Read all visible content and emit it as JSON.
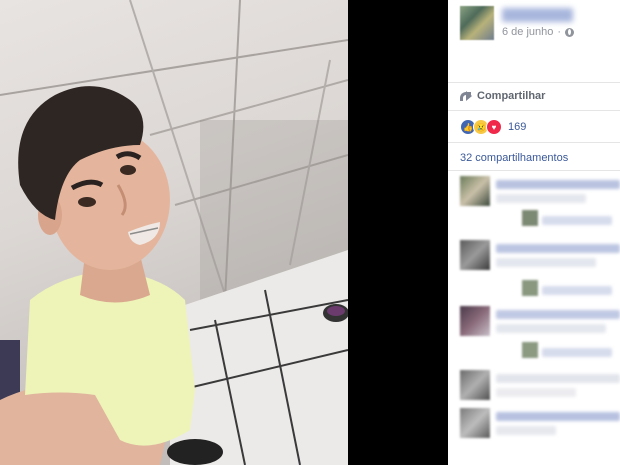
{
  "post": {
    "date": "6 de junho",
    "share_label": "Compartilhar",
    "reaction_count": "169",
    "shares_label": "32 compartilhamentos"
  },
  "icons": {
    "globe": "globe-icon",
    "share": "share-arrow-icon",
    "like": "like-reaction-icon",
    "sad": "sad-reaction-icon",
    "love": "love-reaction-icon"
  },
  "colors": {
    "link": "#3b5998",
    "muted": "#90949c",
    "like": "#4267b2",
    "love": "#f0284a",
    "sad": "#f7c945"
  }
}
